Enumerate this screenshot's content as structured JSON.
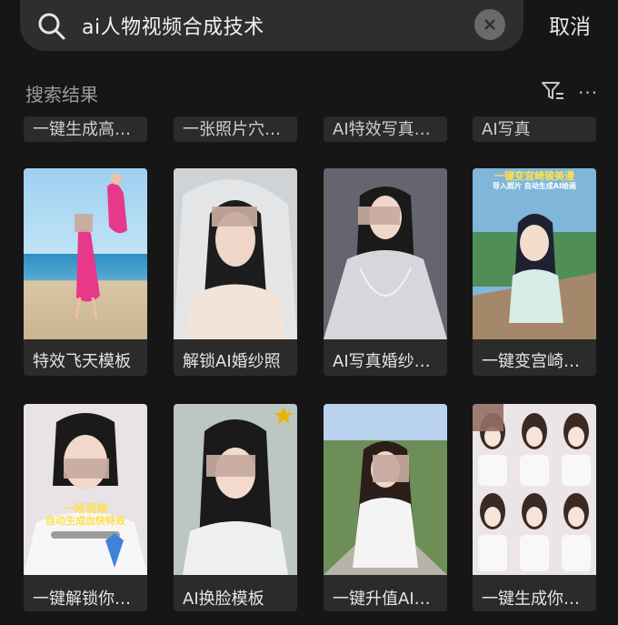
{
  "search": {
    "query": "ai人物视频合成技术",
    "cancel_label": "取消"
  },
  "results": {
    "title": "搜索结果",
    "more": "···"
  },
  "top_row": [
    {
      "label": "一键生成高…"
    },
    {
      "label": "一张照片穴…"
    },
    {
      "label": "AI特效写真…"
    },
    {
      "label": "AI写真"
    }
  ],
  "cards": [
    {
      "label": "特效飞天模板"
    },
    {
      "label": "解锁AI婚纱照"
    },
    {
      "label": "AI写真婚纱…"
    },
    {
      "label": "一键变宫崎…",
      "overlay_title": "一键变宫崎骏美漫",
      "overlay_sub": "导入照片 自动生成AI绘画"
    },
    {
      "label": "一键解锁你…",
      "overlay_title": "一段视频",
      "overlay_sub": "自动生成血快特效"
    },
    {
      "label": "AI换脸模板"
    },
    {
      "label": "一键升值AI…"
    },
    {
      "label": "一键生成你…"
    }
  ],
  "colors": {
    "background": "#161616",
    "card": "#2b2b2b",
    "badge": "#e9b500"
  }
}
